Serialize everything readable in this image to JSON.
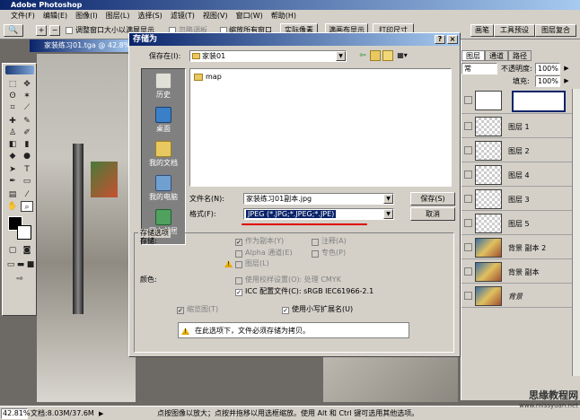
{
  "app": {
    "title": "Adobe Photoshop"
  },
  "menu": [
    "文件(F)",
    "编辑(E)",
    "图像(I)",
    "图层(L)",
    "选择(S)",
    "滤镜(T)",
    "视图(V)",
    "窗口(W)",
    "帮助(H)"
  ],
  "options_bar": {
    "resize_windows_label": "调整窗口大小以满屏显示",
    "ignore_palettes_label": "忽略调板",
    "zoom_all_label": "缩放所有窗口",
    "actual_pixels": "实际像素",
    "fit_on_screen": "满画布显示",
    "print_size": "打印尺寸"
  },
  "palette_tabs": [
    "画笔",
    "工具预设",
    "图层复合"
  ],
  "document": {
    "title": "家装练习01.tga @ 42.8% (背景 副本..."
  },
  "dialog": {
    "title": "存储为",
    "save_in_label": "保存在(I):",
    "save_in_value": "家装01",
    "places": [
      "历史",
      "桌面",
      "我的文档",
      "我的电脑",
      "网上邻居"
    ],
    "files": [
      "map"
    ],
    "filename_label": "文件名(N):",
    "filename_value": "家装练习01副本.jpg",
    "format_label": "格式(F):",
    "format_value": "JPEG (*.JPG;*.JPEG;*.JPE)",
    "save_button": "保存(S)",
    "cancel_button": "取消",
    "save_options_title": "存储选项",
    "storage_label": "存储:",
    "as_copy": "作为副本(Y)",
    "annotations": "注释(A)",
    "alpha_channels": "Alpha 通道(E)",
    "spot_colors": "专色(P)",
    "layers": "图层(L)",
    "color_label": "颜色:",
    "use_proof_setup": "使用校样设置(O): 处理 CMYK",
    "icc_profile": "ICC 配置文件(C): sRGB IEC61966-2.1",
    "thumbnail": "缩览图(T)",
    "lowercase_ext": "使用小写扩展名(U)",
    "warning_msg": "在此选项下，文件必须存储为拷贝。"
  },
  "layers_panel": {
    "tabs": [
      "图层",
      "通道",
      "路径"
    ],
    "blend_mode": "常",
    "opacity_label": "不透明度:",
    "opacity_value": "100%",
    "fill_label": "填充:",
    "fill_value": "100%",
    "layers": [
      "",
      "图层 1",
      "图层 2",
      "图层 4",
      "图层 3",
      "图层 5",
      "背景 副本 2",
      "背景 副本",
      "背景"
    ]
  },
  "status": {
    "zoom": "42.81%",
    "doc_info": "文档:8.03M/37.6M",
    "hint": "点按图像以放大；点按并拖移以用选框缩放。使用 Alt 和 Ctrl 键可选用其他选项。"
  },
  "watermark": {
    "cn": "思缘教程网",
    "url": "www.missyuan.net"
  }
}
